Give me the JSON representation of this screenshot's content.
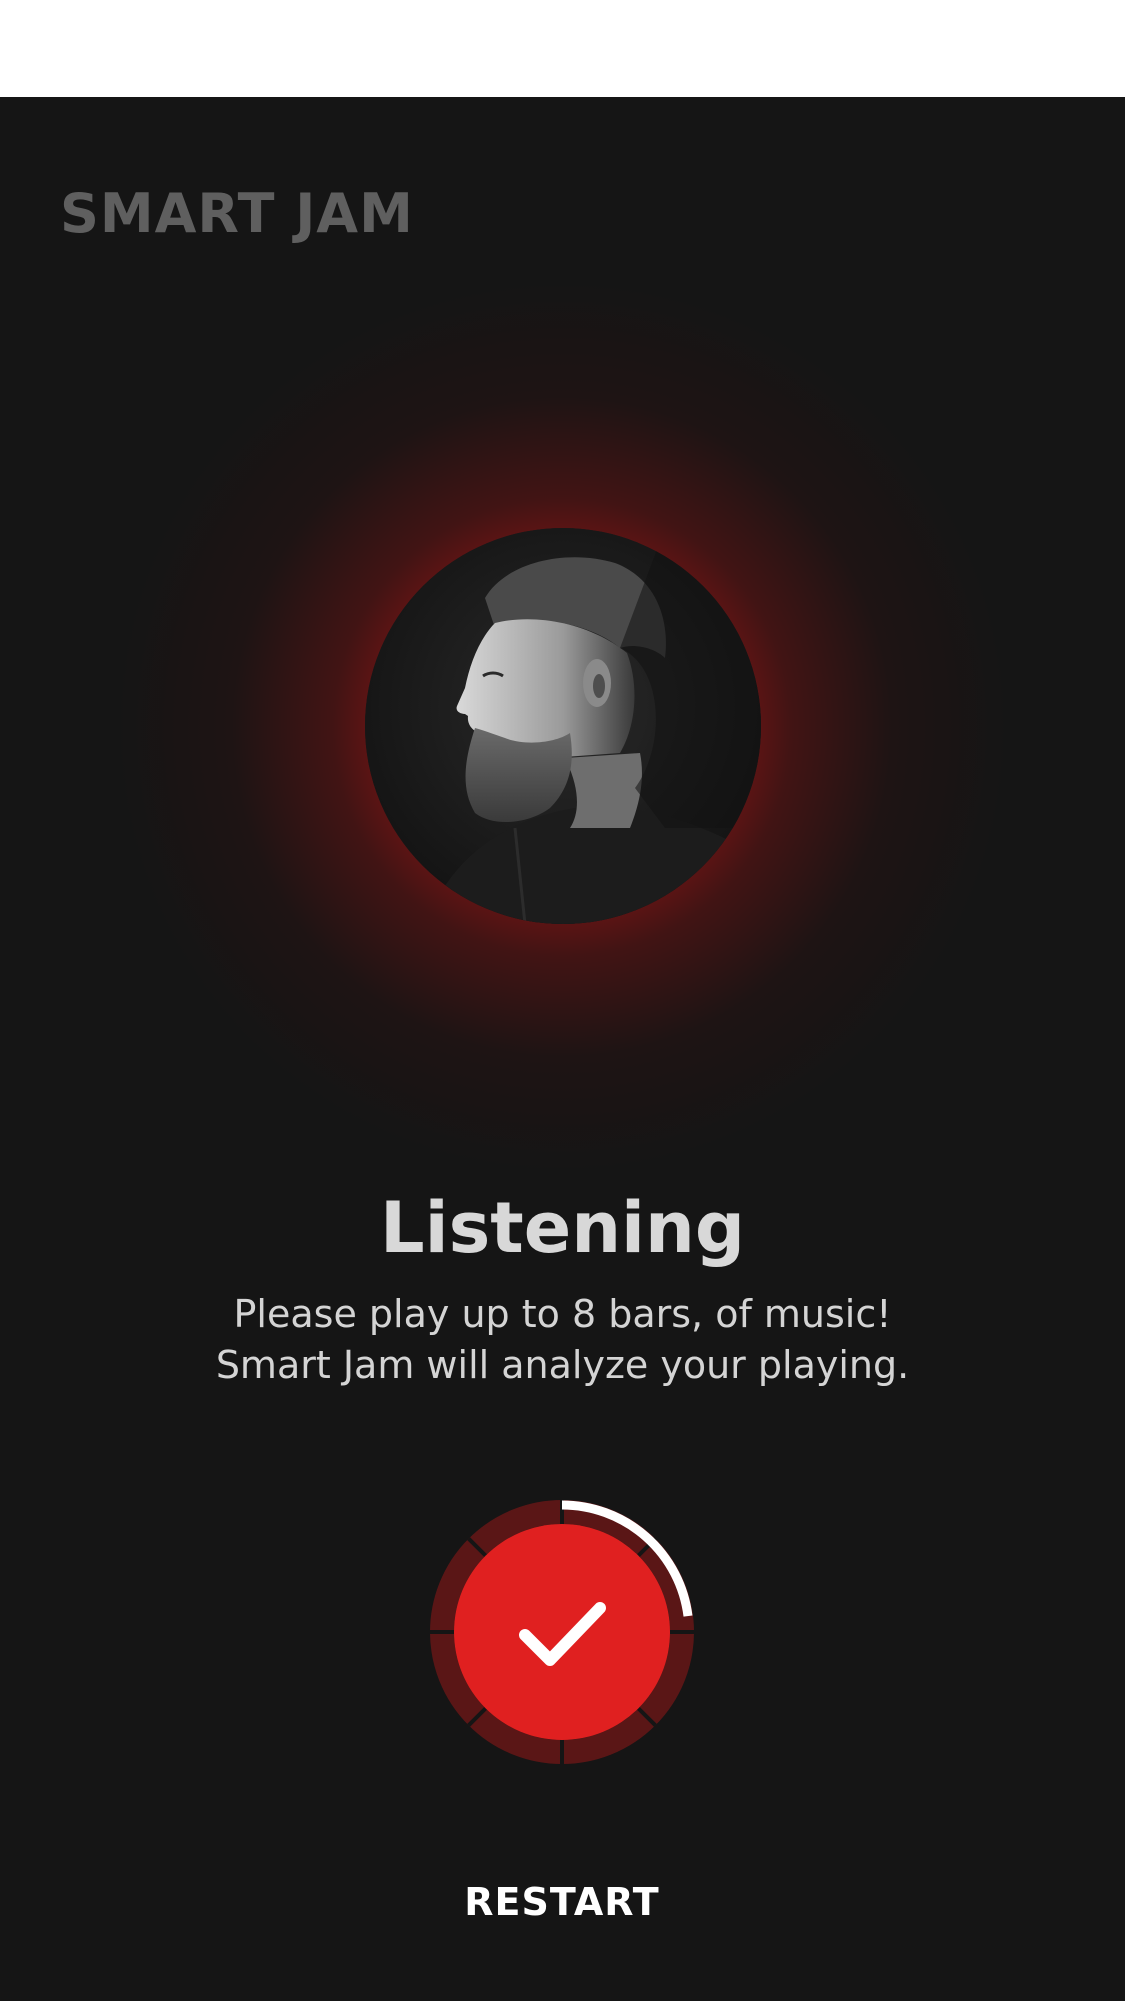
{
  "app": {
    "brand": "SMART JAM"
  },
  "status": {
    "title": "Listening",
    "line1": "Please play up to 8 bars, of music!",
    "line2": "Smart Jam will analyze your playing."
  },
  "progress": {
    "segments": 8,
    "fraction": 0.23,
    "icon": "checkmark-icon"
  },
  "actions": {
    "restart_label": "RESTART"
  },
  "colors": {
    "background": "#151515",
    "accent": "#e02020",
    "ring_track": "#5a1616",
    "ring_progress": "#ffffff",
    "brand_text": "#5f5f5f"
  }
}
